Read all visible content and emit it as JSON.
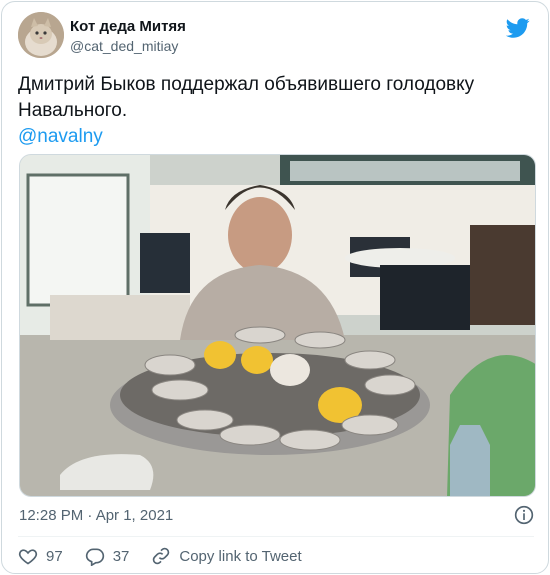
{
  "author": {
    "display_name": "Кот деда Митяя",
    "handle": "@cat_ded_mitiay"
  },
  "tweet": {
    "text": "Дмитрий Быков поддержал объявившего голодовку Навального.",
    "mention": "@navalny"
  },
  "media": {
    "alt": "Photo"
  },
  "meta": {
    "timestamp": "12:28 PM · Apr 1, 2021"
  },
  "actions": {
    "likes": "97",
    "replies": "37",
    "copy_link": "Copy link to Tweet"
  },
  "colors": {
    "brand": "#1d9bf0",
    "text": "#0f1419",
    "secondary": "#536471",
    "border": "#cfd9de"
  },
  "icons": [
    "twitter-bird-icon",
    "info-icon",
    "heart-icon",
    "reply-icon",
    "link-icon"
  ]
}
